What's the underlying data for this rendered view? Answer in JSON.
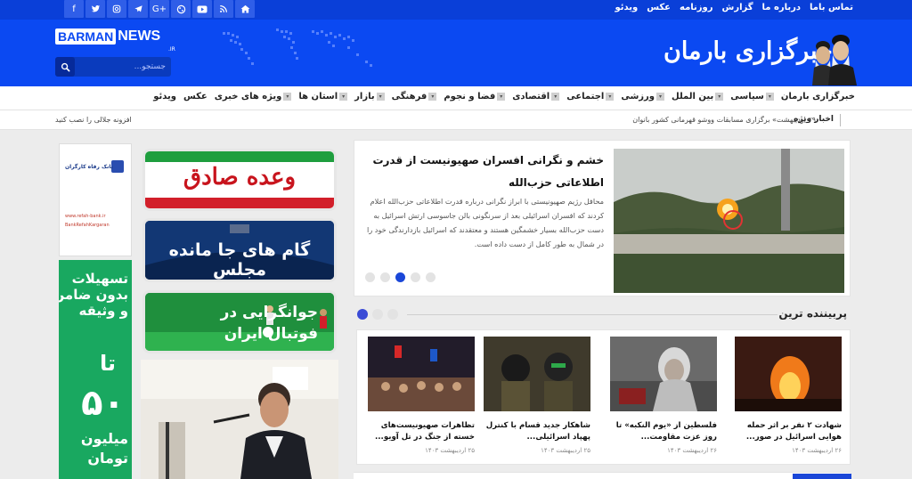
{
  "topbar": {
    "social_icons": [
      "facebook-icon",
      "twitter-icon",
      "instagram-icon",
      "telegram-icon",
      "google-plus-icon",
      "aparat-icon",
      "youtube-icon",
      "rss-icon",
      "home-icon"
    ],
    "links": [
      "تماس باما",
      "درباره ما",
      "گزارش",
      "روزنامه",
      "عکس",
      "ویدئو"
    ]
  },
  "header": {
    "brand_en_1": "BARMAN",
    "brand_en_2": "NEWS",
    "brand_en_tld": ".IR",
    "brand_fa": "خبرگزاری بارمان",
    "search_placeholder": "جستجو..."
  },
  "nav": {
    "items": [
      {
        "label": "خبرگزاری بارمان",
        "caret": false
      },
      {
        "label": "سیاسی",
        "caret": true
      },
      {
        "label": "بین الملل",
        "caret": true
      },
      {
        "label": "ورزشی",
        "caret": true
      },
      {
        "label": "اجتماعی",
        "caret": true
      },
      {
        "label": "اقتصادی",
        "caret": true
      },
      {
        "label": "فضا و نجوم",
        "caret": true
      },
      {
        "label": "فرهنگی",
        "caret": true
      },
      {
        "label": "بازار",
        "caret": true
      },
      {
        "label": "استان ها",
        "caret": true
      },
      {
        "label": "ویژه های خبری",
        "caret": true
      },
      {
        "label": "عکس",
        "caret": false
      },
      {
        "label": "ویدئو",
        "caret": false
      }
    ]
  },
  "ticker": {
    "label": "اخبار ویژه",
    "text": "۲۹ اردیبهشت» برگزاری مسابقات ووشو قهرمانی کشور بانوان",
    "left_text": "افزونه جلالی را نصب کنید"
  },
  "ads": {
    "bank_name": "بانک رفاه کارگران",
    "bank_line1": "www.refah-bank.ir",
    "bank_line2": "BankRefahKargaran",
    "green_line1": "تسهیلات",
    "green_line2": "بدون ضامن",
    "green_line3": "و وثیقه",
    "green_till": "تا",
    "green_amount": "۵۰",
    "green_unit1": "میلیون",
    "green_unit2": "تومان",
    "banner_vaade": "وعده صادق",
    "banner_majles": "گام های جا مانده مجلس",
    "banner_football_1": "جوانگرایی در",
    "banner_football_2": "فوتبال ایران"
  },
  "featured": {
    "title": "خشم و نگرانی افسران صهیونیست از قدرت اطلاعاتی حزب‌الله",
    "summary": "محافل رژیم صهیونیستی با ابراز نگرانی درباره قدرت اطلاعاتی حزب‌الله اعلام کردند که افسران اسرائیلی بعد از سرنگونی بالن جاسوسی ارتش اسرائیل به دست حزب‌الله بسیار خشمگین هستند و معتقدند که اسرائیل بازدارندگی خود را در شمال به طور کامل از دست داده است.",
    "slider_count": 5,
    "slider_active": 3
  },
  "popular": {
    "title": "پربیننده ترین",
    "pager_count": 3,
    "pager_active": 1,
    "cards": [
      {
        "title": "شهادت ۲ نفر بر اثر حمله هوایی اسرائیل در صور...",
        "date": "۲۶ اردیبهشت ۱۴۰۳"
      },
      {
        "title": "فلسطین از «یوم النکبه» تا روز عزت مقاومت...",
        "date": "۲۶ اردیبهشت ۱۴۰۳"
      },
      {
        "title": "شاهکار جدید قسام با کنترل پهپاد اسرائیلی...",
        "date": "۲۵ اردیبهشت ۱۴۰۳"
      },
      {
        "title": "تظاهرات صهیونیست‌های خسته از جنگ در تل آویو...",
        "date": "۲۵ اردیبهشت ۱۴۰۳"
      }
    ]
  },
  "colors": {
    "brand_blue": "#0b49f2",
    "top_blue": "#0a3fd8",
    "accent": "#1a47d8",
    "green_ad": "#19a860"
  }
}
